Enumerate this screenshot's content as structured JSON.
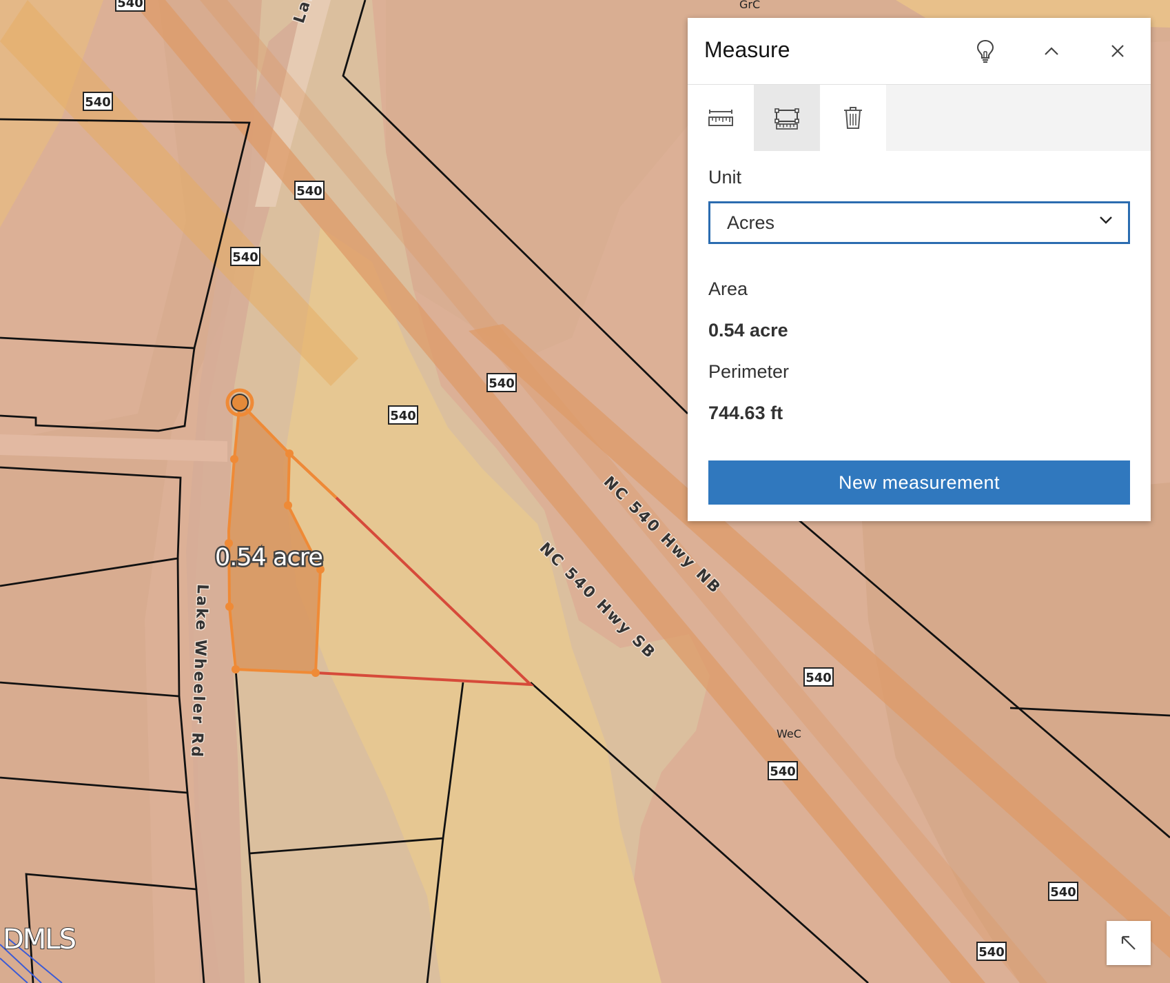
{
  "map": {
    "route_shields": [
      "540",
      "540",
      "540",
      "540",
      "540",
      "540",
      "540",
      "540",
      "540",
      "540",
      "540"
    ],
    "road_labels": {
      "lake_wheeler": "Lake Wheeler Rd",
      "lake_wheeler_top": "Lal",
      "nb": "NC 540 Hwy NB",
      "sb": "NC 540 Hwy SB"
    },
    "soil_labels": {
      "grc": "GrC",
      "wec": "WeC"
    },
    "measurement_label": "0.54 acre",
    "watermark": "DMLS",
    "colors": {
      "soil_base": "#dcb096",
      "soil_dark": "#d2a890",
      "soil_light": "#e2c3a6",
      "soil_yellow": "#e7c590",
      "highway_band": "#dd9b68",
      "measure_fill": "#d8955e",
      "measure_stroke": "#ef8a36",
      "measure_line": "#d64a3a",
      "parcel_line": "#111111"
    }
  },
  "panel": {
    "title": "Measure",
    "header_icons": [
      "lightbulb-icon",
      "chevron-up-icon",
      "close-icon"
    ],
    "tabs": [
      {
        "name": "distance",
        "icon": "ruler-icon",
        "active": false
      },
      {
        "name": "area",
        "icon": "area-measure-icon",
        "active": true
      },
      {
        "name": "clear",
        "icon": "trash-icon",
        "active": false
      }
    ],
    "unit_label": "Unit",
    "unit_value": "Acres",
    "area_label": "Area",
    "area_value": "0.54 acre",
    "perimeter_label": "Perimeter",
    "perimeter_value": "744.63 ft",
    "new_button": "New measurement",
    "accent_color": "#3078be"
  },
  "corner_button_icon": "arrow-up-left-icon"
}
